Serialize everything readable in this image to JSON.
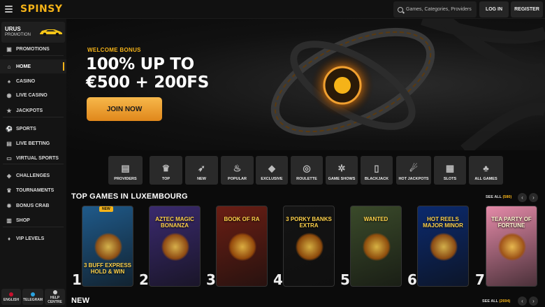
{
  "header": {
    "logo": "SPINSY",
    "search_placeholder": "Games, Categories, Providers",
    "login": "LOG IN",
    "register": "REGISTER"
  },
  "sidebar": {
    "promo": {
      "title": "URUS",
      "subtitle": "PROMOTION"
    },
    "items": [
      {
        "label": "PROMOTIONS",
        "icon": "gift-icon"
      },
      {
        "label": "HOME",
        "icon": "home-icon",
        "active": true
      },
      {
        "label": "CASINO",
        "icon": "casino-icon"
      },
      {
        "label": "LIVE CASINO",
        "icon": "live-casino-icon"
      },
      {
        "label": "JACKPOTS",
        "icon": "jackpot-icon"
      },
      {
        "label": "SPORTS",
        "icon": "sports-icon"
      },
      {
        "label": "LIVE BETTING",
        "icon": "live-betting-icon"
      },
      {
        "label": "VIRTUAL SPORTS",
        "icon": "virtual-sports-icon"
      },
      {
        "label": "CHALLENGES",
        "icon": "challenges-icon"
      },
      {
        "label": "TOURNAMENTS",
        "icon": "trophy-icon"
      },
      {
        "label": "BONUS CRAB",
        "icon": "crab-icon"
      },
      {
        "label": "SHOP",
        "icon": "shop-icon"
      },
      {
        "label": "VIP LEVELS",
        "icon": "vip-icon"
      }
    ],
    "footer": [
      {
        "label": "ENGLISH",
        "icon": "uk-flag-icon"
      },
      {
        "label": "TELEGRAM",
        "icon": "telegram-icon"
      },
      {
        "label": "HELP CENTRE",
        "icon": "help-icon"
      }
    ]
  },
  "hero": {
    "kicker": "WELCOME BONUS",
    "line1": "100% UP TO",
    "line2": "€500 + 200FS",
    "cta": "JOIN NOW"
  },
  "categories": [
    {
      "label": "PROVIDERS",
      "icon": "book-icon"
    },
    {
      "label": "TOP",
      "icon": "crown-icon"
    },
    {
      "label": "NEW",
      "icon": "rocket-icon"
    },
    {
      "label": "POPULAR",
      "icon": "fire-icon"
    },
    {
      "label": "EXCLUSIVE",
      "icon": "diamond-icon"
    },
    {
      "label": "ROULETTE",
      "icon": "roulette-icon"
    },
    {
      "label": "GAME SHOWS",
      "icon": "ferris-wheel-icon"
    },
    {
      "label": "BLACKJACK",
      "icon": "cards-icon"
    },
    {
      "label": "HOT JACKPOTS",
      "icon": "chili-icon"
    },
    {
      "label": "SLOTS",
      "icon": "slot-icon"
    },
    {
      "label": "ALL GAMES",
      "icon": "cherries-icon"
    }
  ],
  "top_games": {
    "title": "TOP GAMES IN LUXEMBOURG",
    "see_all": "SEE ALL",
    "count": "(580)",
    "games": [
      {
        "rank": "1",
        "title": "3 BUFF EXPRESS HOLD & WIN",
        "badge": "NEW",
        "bg": "#1f5a8a"
      },
      {
        "rank": "2",
        "title": "AZTEC MAGIC BONANZA",
        "bg": "#3a2a6e"
      },
      {
        "rank": "3",
        "title": "BOOK OF RA",
        "bg": "#6a1e14"
      },
      {
        "rank": "4",
        "title": "3 PORKY BANKS EXTRA",
        "bg": "#141414"
      },
      {
        "rank": "5",
        "title": "WANTED",
        "bg": "#3a4a2a"
      },
      {
        "rank": "6",
        "title": "HOT REELS MAJOR MINOR",
        "bg": "#0b2a6e"
      },
      {
        "rank": "7",
        "title": "TEA PARTY OF FORTUNE",
        "bg": "#e48aa8"
      }
    ]
  },
  "new_section": {
    "title": "NEW",
    "see_all": "SEE ALL",
    "count": "(2694)"
  }
}
